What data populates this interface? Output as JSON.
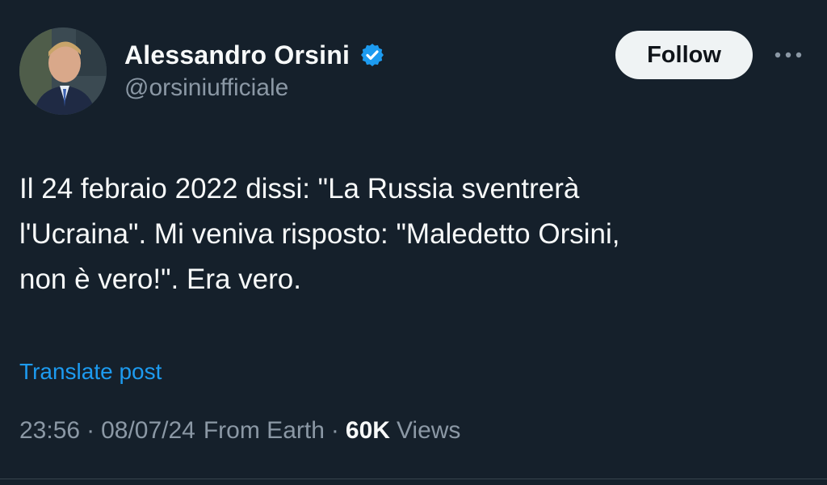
{
  "author": {
    "display_name": "Alessandro Orsini",
    "handle": "@orsiniufficiale",
    "verified": true,
    "verified_color": "#1d9bf0"
  },
  "actions": {
    "follow_label": "Follow",
    "more_icon": "more-horizontal-icon"
  },
  "post": {
    "lines": [
      "Il 24 febraio 2022 dissi: \"La Russia sventrerà",
      "l'Ucraina\". Mi veniva risposto: \"Maledetto Orsini,",
      "non è vero!\". Era vero."
    ],
    "translate_label": "Translate post"
  },
  "meta": {
    "time": "23:56",
    "separator": "·",
    "date": "08/07/24",
    "location": "From Earth",
    "views_count": "60K",
    "views_label": "Views"
  },
  "colors": {
    "background": "#15202b",
    "primary_text": "#f7f9f9",
    "secondary_text": "#8b98a5",
    "accent": "#1d9bf0"
  }
}
